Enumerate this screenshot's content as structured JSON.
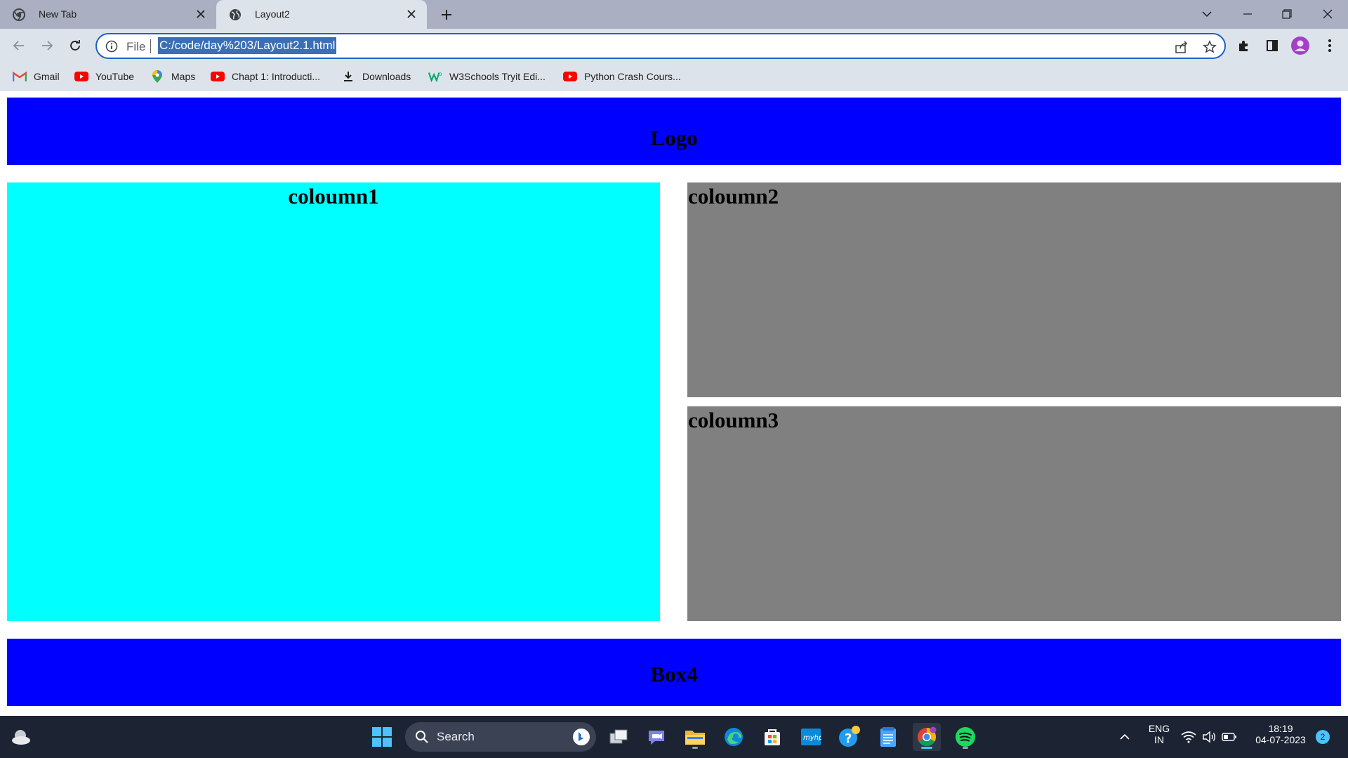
{
  "browser": {
    "tabs": [
      {
        "title": "New Tab",
        "active": false
      },
      {
        "title": "Layout2",
        "active": true
      }
    ],
    "address": {
      "scheme_label": "File",
      "url": "C:/code/day%203/Layout2.1.html"
    },
    "bookmarks": [
      {
        "label": "Gmail",
        "icon": "gmail-icon"
      },
      {
        "label": "YouTube",
        "icon": "youtube-icon"
      },
      {
        "label": "Maps",
        "icon": "maps-icon"
      },
      {
        "label": "Chapt 1: Introducti...",
        "icon": "youtube-icon"
      },
      {
        "label": "Downloads",
        "icon": "download-icon"
      },
      {
        "label": "W3Schools Tryit Edi...",
        "icon": "w3schools-icon"
      },
      {
        "label": "Python Crash Cours...",
        "icon": "youtube-icon"
      }
    ]
  },
  "page": {
    "logo": "Logo",
    "column1": "coloumn1",
    "column2": "coloumn2",
    "column3": "coloumn3",
    "box4": "Box4",
    "colors": {
      "blue": "#0000ff",
      "cyan": "#00ffff",
      "grey": "#808080"
    }
  },
  "taskbar": {
    "search_label": "Search",
    "lang_top": "ENG",
    "lang_bottom": "IN",
    "time": "18:19",
    "date": "04-07-2023",
    "notification_count": "2"
  }
}
